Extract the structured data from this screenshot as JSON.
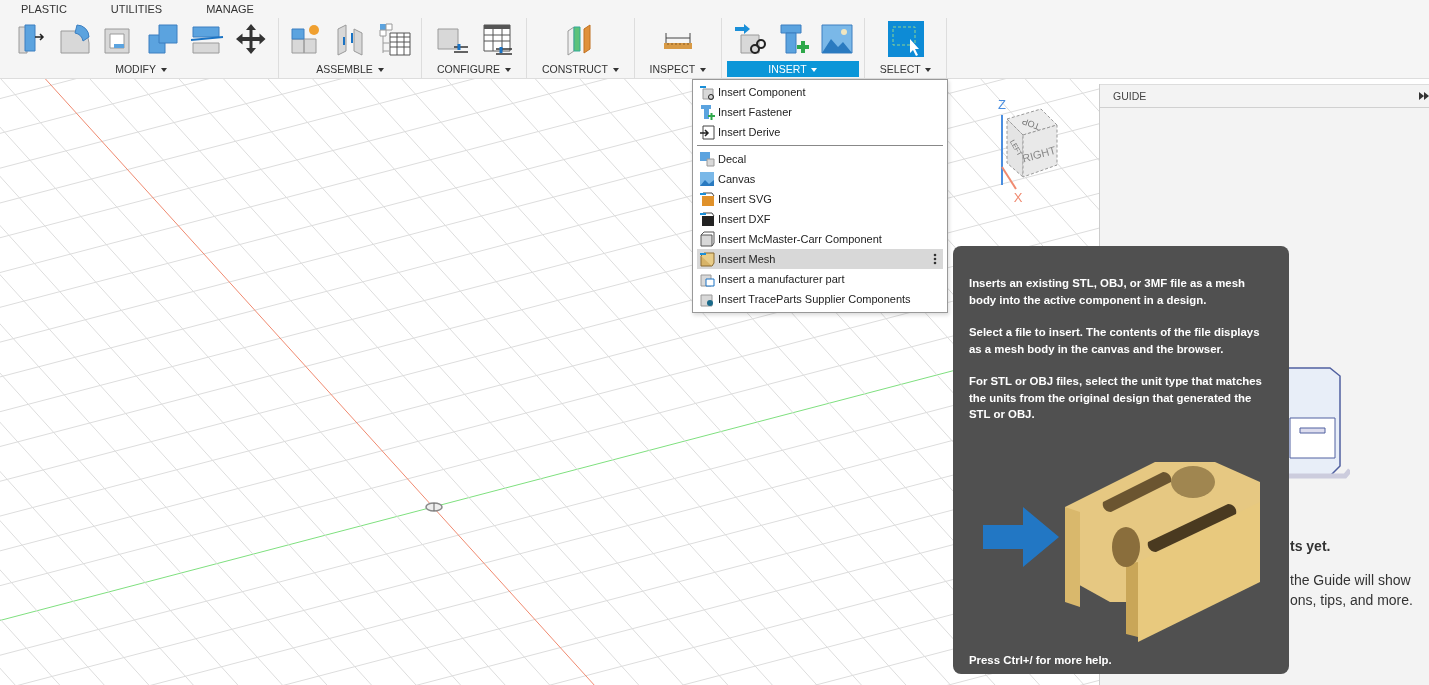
{
  "toolbar": {
    "tabs": [
      {
        "label": "PLASTIC"
      },
      {
        "label": "UTILITIES"
      },
      {
        "label": "MANAGE"
      }
    ],
    "groups": [
      {
        "label": "MODIFY",
        "selected": false
      },
      {
        "label": "ASSEMBLE",
        "selected": false
      },
      {
        "label": "CONFIGURE",
        "selected": false
      },
      {
        "label": "CONSTRUCT",
        "selected": false
      },
      {
        "label": "INSPECT",
        "selected": false
      },
      {
        "label": "INSERT",
        "selected": true
      },
      {
        "label": "SELECT",
        "selected": false
      }
    ]
  },
  "insert_menu": {
    "sections": [
      [
        {
          "label": "Insert Component",
          "selected": false
        },
        {
          "label": "Insert Fastener",
          "selected": false
        },
        {
          "label": "Insert Derive",
          "selected": false
        }
      ],
      [
        {
          "label": "Decal",
          "selected": false
        },
        {
          "label": "Canvas",
          "selected": false
        },
        {
          "label": "Insert SVG",
          "selected": false
        },
        {
          "label": "Insert DXF",
          "selected": false
        },
        {
          "label": "Insert McMaster-Carr Component",
          "selected": false
        },
        {
          "label": "Insert Mesh",
          "selected": true
        },
        {
          "label": "Insert a manufacturer part",
          "selected": false
        },
        {
          "label": "Insert TraceParts Supplier Components",
          "selected": false
        }
      ]
    ]
  },
  "view_cube": {
    "faces": [
      "TOP",
      "LEFT",
      "RIGHT"
    ],
    "axes": [
      "Z",
      "X"
    ]
  },
  "guide": {
    "title": "GUIDE",
    "lines": [
      {
        "text": "ts yet.",
        "kind": "heading"
      },
      {
        "text": "the Guide will show",
        "kind": "body"
      },
      {
        "text": "ons, tips, and more.",
        "kind": "body"
      }
    ]
  },
  "tooltip": {
    "paragraphs": [
      "Inserts an existing STL, OBJ, or 3MF file as a mesh body into the active component in a design.",
      "Select a file to insert. The contents of the file displays as a mesh body in the canvas and the browser.",
      "For STL or OBJ files, select the unit type that matches the units from the original design that generated the STL or OBJ."
    ],
    "footer": "Press Ctrl+/ for more help."
  }
}
